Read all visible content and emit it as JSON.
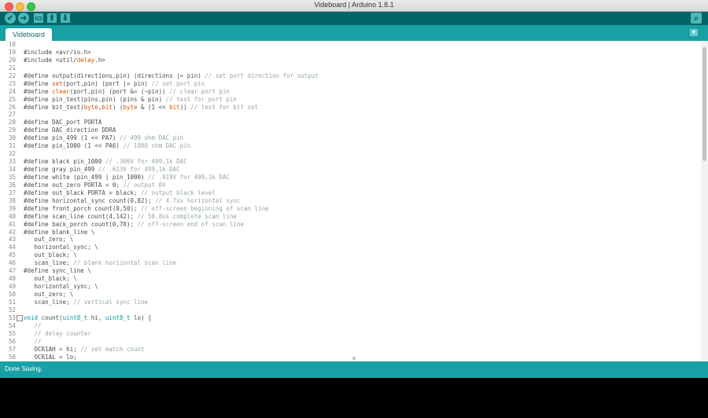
{
  "window": {
    "title": "Videboard | Arduino 1.8.1"
  },
  "toolbar": {
    "verify": "✔",
    "upload": "➜",
    "new": "▭",
    "open": "⬆",
    "save": "⬇",
    "serial": "⌕"
  },
  "tab": {
    "label": "Videboard",
    "menu_icon": "▼"
  },
  "code_lines": [
    {
      "n": "18",
      "t": ""
    },
    {
      "n": "19",
      "t": "#include <avr/io.h>"
    },
    {
      "n": "20",
      "t": "#include <util/delay.h>"
    },
    {
      "n": "21",
      "t": ""
    },
    {
      "n": "22",
      "t": "#define output(directions,pin) (directions |= pin) // set port direction for output"
    },
    {
      "n": "23",
      "t": "#define set(port,pin) (port |= pin) // set port pin"
    },
    {
      "n": "24",
      "t": "#define clear(port,pin) (port &= (~pin)) // clear port pin"
    },
    {
      "n": "25",
      "t": "#define pin_test(pins,pin) (pins & pin) // test for port pin"
    },
    {
      "n": "26",
      "t": "#define bit_test(byte,bit) (byte & (1 << bit)) // test for bit set"
    },
    {
      "n": "27",
      "t": ""
    },
    {
      "n": "28",
      "t": "#define DAC_port PORTA"
    },
    {
      "n": "29",
      "t": "#define DAC_direction DDRA"
    },
    {
      "n": "30",
      "t": "#define pin_499 (1 << PA7) // 499 ohm DAC pin"
    },
    {
      "n": "31",
      "t": "#define pin_1000 (1 << PA6) // 1000 ohm DAC pin"
    },
    {
      "n": "32",
      "t": ""
    },
    {
      "n": "33",
      "t": "#define black pin_1000 // .306V for 499,1k DAC"
    },
    {
      "n": "34",
      "t": "#define gray pin_499 // .613V for 499,1k DAC"
    },
    {
      "n": "35",
      "t": "#define white (pin_499 | pin_1000) // .919V for 499,1k DAC"
    },
    {
      "n": "36",
      "t": "#define out_zero PORTA = 0; // output 0V"
    },
    {
      "n": "37",
      "t": "#define out_black PORTA = black; // output black level"
    },
    {
      "n": "38",
      "t": "#define horizontal_sync count(0,82); // 4.7us horizontal sync"
    },
    {
      "n": "39",
      "t": "#define front_porch count(0,50); // off-screen beginning of scan line"
    },
    {
      "n": "40",
      "t": "#define scan_line count(4,142); // 58.8us complete scan line"
    },
    {
      "n": "41",
      "t": "#define back_porch count(0,70); // off-screen end of scan line"
    },
    {
      "n": "42",
      "t": "#define blank_line \\"
    },
    {
      "n": "43",
      "t": "   out_zero; \\"
    },
    {
      "n": "44",
      "t": "   horizontal_sync; \\"
    },
    {
      "n": "45",
      "t": "   out_black; \\"
    },
    {
      "n": "46",
      "t": "   scan_line; // blank horizontal scan line"
    },
    {
      "n": "47",
      "t": "#define sync_line \\"
    },
    {
      "n": "48",
      "t": "   out_black; \\"
    },
    {
      "n": "49",
      "t": "   horizontal_sync; \\"
    },
    {
      "n": "50",
      "t": "   out_zero; \\"
    },
    {
      "n": "51",
      "t": "   scan_line; // vertical sync line"
    },
    {
      "n": "52",
      "t": ""
    },
    {
      "n": "53",
      "t": "void count(uint8_t hi, uint8_t lo) {"
    },
    {
      "n": "54",
      "t": "   //"
    },
    {
      "n": "55",
      "t": "   // delay counter"
    },
    {
      "n": "56",
      "t": "   //"
    },
    {
      "n": "57",
      "t": "   OCR1AH = hi; // set match count"
    },
    {
      "n": "58",
      "t": "   OCR1AL = lo;"
    }
  ],
  "status": {
    "message": "Done Saving."
  },
  "colors": {
    "toolbar_bg": "#006468",
    "tabbar_bg": "#17a1a5",
    "button_bg": "#4db7bb",
    "code_text": "#434f54",
    "line_number": "#888888",
    "comment": "#95a5a6",
    "keyword": "#d35400",
    "type": "#00979c"
  }
}
